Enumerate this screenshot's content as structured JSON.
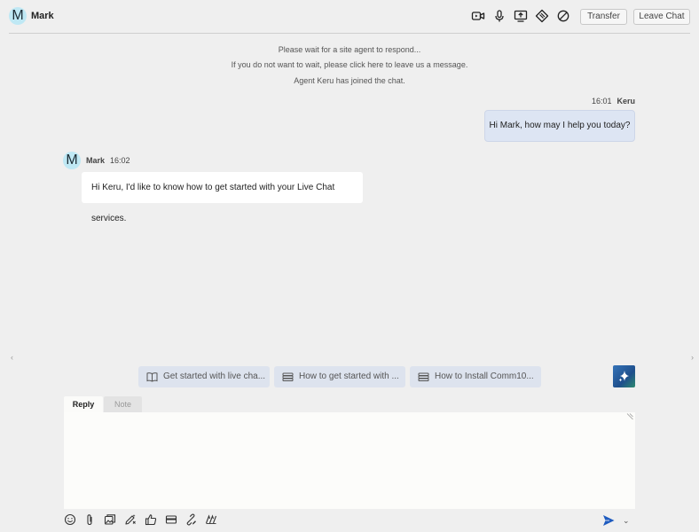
{
  "header": {
    "avatar_letter": "M",
    "contact_name": "Mark",
    "icons": [
      "video-call-icon",
      "microphone-icon",
      "screen-share-icon",
      "ticket-icon",
      "block-icon"
    ],
    "transfer_label": "Transfer",
    "leave_label": "Leave Chat"
  },
  "system_messages": [
    "Please wait for a site agent to respond...",
    "If you do not want to wait, please click here to leave us a message.",
    "Agent Keru has joined the chat."
  ],
  "messages": [
    {
      "sender": "Keru",
      "time": "16:01",
      "text": "Hi Mark, how may I help you today?",
      "side": "right"
    },
    {
      "sender": "Mark",
      "avatar_letter": "M",
      "time": "16:02",
      "text": "Hi Keru, I'd like to know how to get started with your Live Chat services.",
      "side": "left"
    }
  ],
  "suggestions": [
    {
      "icon": "book-icon",
      "label": "Get started with live cha..."
    },
    {
      "icon": "stack-icon",
      "label": "How to get started with ..."
    },
    {
      "icon": "stack-icon",
      "label": "How to Install Comm10..."
    }
  ],
  "composer": {
    "tabs": [
      {
        "label": "Reply",
        "active": true
      },
      {
        "label": "Note",
        "active": false
      }
    ],
    "text": "",
    "tools": [
      "emoji-icon",
      "attachment-icon",
      "gallery-icon",
      "magic-pen-icon",
      "thumbs-up-icon",
      "card-icon",
      "link-edit-icon",
      "signature-icon"
    ],
    "send_icon": "send-icon"
  },
  "colors": {
    "background": "#efefef",
    "agent_bubble": "#dde5f3",
    "avatar": "#bfe8f4",
    "suggestion": "#dde3ee",
    "send": "#1e5bbf"
  }
}
